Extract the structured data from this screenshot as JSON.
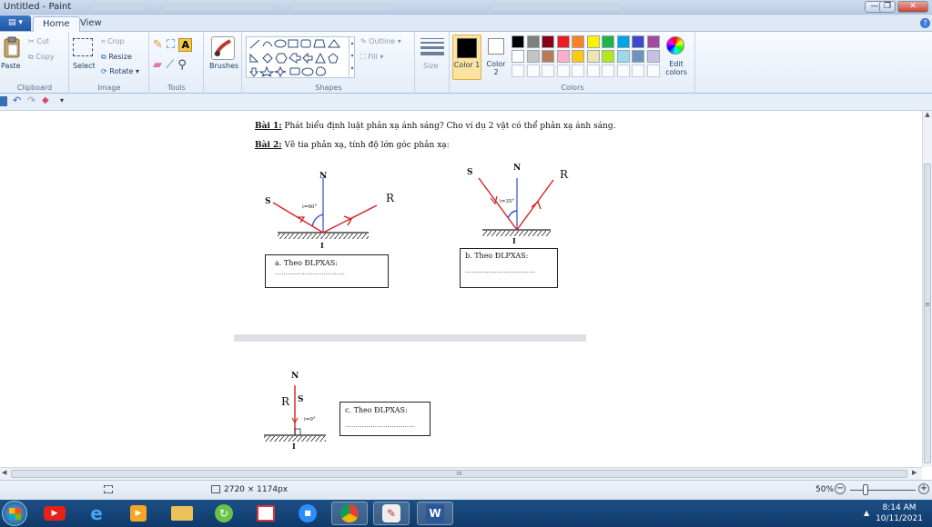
{
  "window": {
    "title": "Untitled - Paint",
    "controls": [
      "—",
      "❐",
      "✕"
    ]
  },
  "menu": {
    "file_glyph": "▤ ▾",
    "tabs": [
      "Home",
      "View"
    ],
    "help_glyph": "?"
  },
  "ribbon": {
    "clipboard": {
      "paste": "Paste",
      "cut": "Cut",
      "copy": "Copy",
      "label": "Clipboard"
    },
    "image": {
      "select": "Select",
      "crop": "Crop",
      "resize": "Resize",
      "rotate": "Rotate",
      "label": "Image"
    },
    "tools": {
      "label": "Tools"
    },
    "brushes": {
      "label": "Brushes"
    },
    "shapes": {
      "label": "Shapes",
      "outline": "Outline",
      "fill": "Fill"
    },
    "size": {
      "label": "Size"
    },
    "color1": {
      "label": "Color 1",
      "color": "#000000"
    },
    "color2": {
      "label": "Color 2",
      "color": "#ffffff"
    },
    "colors": {
      "label": "Colors",
      "palette_row1": [
        "#000000",
        "#7f7f7f",
        "#880015",
        "#ed1c24",
        "#ff7f27",
        "#fff200",
        "#22b14c",
        "#00a2e8",
        "#3f48cc",
        "#a349a4"
      ],
      "palette_row2": [
        "#ffffff",
        "#c3c3c3",
        "#b97a57",
        "#ffaec9",
        "#ffc90e",
        "#efe4b0",
        "#b5e61d",
        "#99d9ea",
        "#7092be",
        "#c8bfe7"
      ]
    },
    "edit_colors": "Edit colors"
  },
  "document": {
    "q1_label": "Bài 1:",
    "q1_text": "Phát biểu định luật phản xạ ánh sáng? Cho ví dụ 2 vật có thể phản xạ ánh sáng.",
    "q2_label": "Bài 2:",
    "q2_text": "Vẽ tia phản xạ, tính độ lớn góc phản xạ:",
    "diagram_a": {
      "S": "S",
      "N": "N",
      "R": "R",
      "I": "I",
      "angle": "i=60°",
      "box": "a.   Theo ĐLPXAS:",
      "dots": "……………………………"
    },
    "diagram_b": {
      "S": "S",
      "N": "N",
      "R": "R",
      "I": "I",
      "angle": "i=35°",
      "box": "b. Theo ĐLPXAS:",
      "dots": "……………………………"
    },
    "diagram_c": {
      "S": "S",
      "N": "N",
      "R": "R",
      "I": "I",
      "angle": "i=0°",
      "box": "c. Theo ĐLPXAS:",
      "dots": "……………………………"
    }
  },
  "scroll": {
    "hscroll_grip": "III",
    "vscroll_grip": "≡"
  },
  "status": {
    "canvas_size": "2720 × 1174px",
    "zoom": "50%"
  },
  "taskbar": {
    "time": "8:14 AM",
    "date": "10/11/2021",
    "tray_arrow": "▲"
  }
}
